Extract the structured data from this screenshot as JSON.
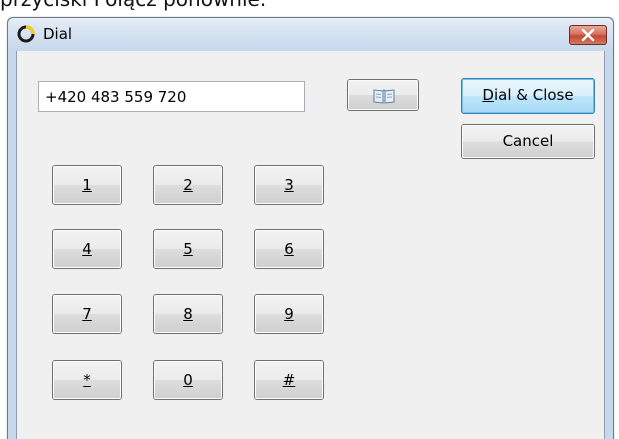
{
  "background_caption": "przyciski Połącz ponownie.",
  "window": {
    "title": "Dial",
    "close_icon": "close-x-icon",
    "app_icon": "ring-logo-icon",
    "colors": {
      "close_red": "#c24a35",
      "accent_ring": "#f2d400",
      "dial_button_blue": "#bee6fd"
    }
  },
  "form": {
    "phone_value": "+420 483 559 720",
    "phonebook_icon": "phonebook-icon"
  },
  "buttons": {
    "dial_close_label_rest": "ial & Close",
    "dial_close_label_accel": "D",
    "cancel_label": "Cancel"
  },
  "keypad": {
    "keys": [
      "1",
      "2",
      "3",
      "4",
      "5",
      "6",
      "7",
      "8",
      "9",
      "*",
      "0",
      "#"
    ]
  }
}
